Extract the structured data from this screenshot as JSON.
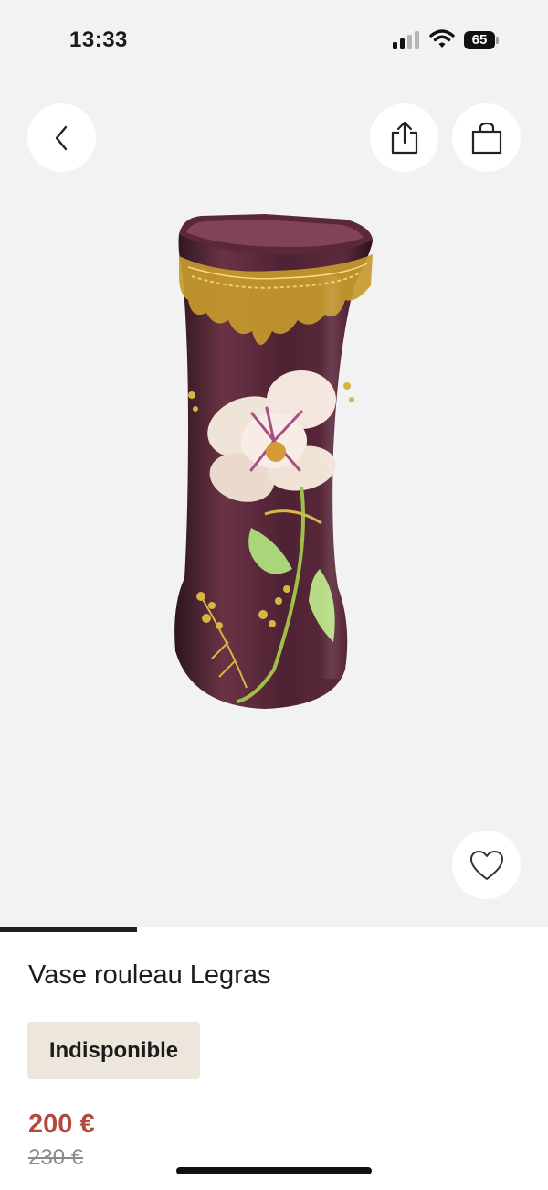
{
  "status_bar": {
    "time": "13:33",
    "battery": "65",
    "signal_icon": "cellular-signal-icon",
    "wifi_icon": "wifi-icon"
  },
  "header": {
    "back_icon": "chevron-left-icon",
    "share_icon": "share-icon",
    "bag_icon": "shopping-bag-icon"
  },
  "gallery": {
    "favorite_icon": "heart-icon",
    "progress": 0.25
  },
  "product": {
    "title": "Vase rouleau Legras",
    "availability": "Indisponible",
    "price": "200 €",
    "old_price": "230 €"
  },
  "colors": {
    "accent_price": "#b34a3c",
    "badge_bg": "#ece6dc",
    "background_gray": "#f2f2f2"
  }
}
